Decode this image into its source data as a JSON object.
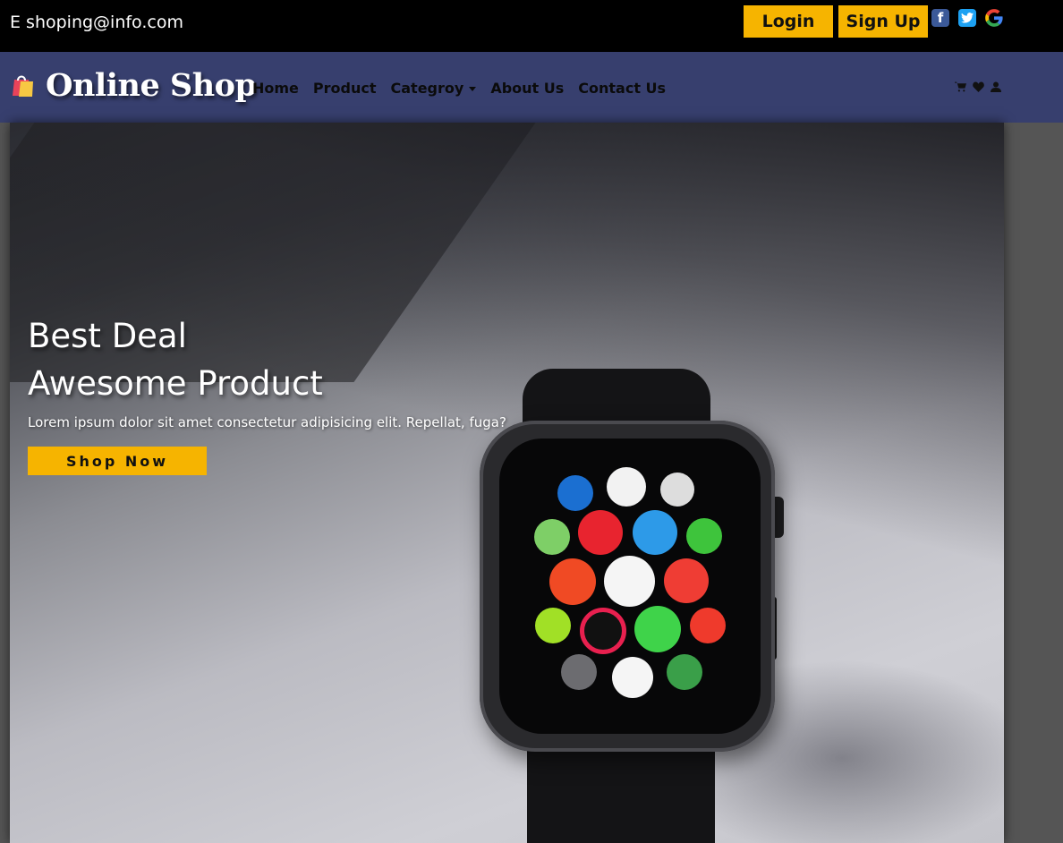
{
  "topbar": {
    "email": "E shoping@info.com",
    "login_label": "Login",
    "signup_label": "Sign Up",
    "social": [
      "facebook-icon",
      "twitter-icon",
      "google-icon"
    ]
  },
  "navbar": {
    "brand": "Online Shop",
    "links": [
      "Home",
      "Product",
      "Categroy",
      "About Us",
      "Contact Us"
    ],
    "icons": [
      "cart-icon",
      "heart-icon",
      "user-icon"
    ]
  },
  "hero": {
    "line1": "Best Deal",
    "line2": "Awesome Product",
    "description": "Lorem ipsum dolor sit amet consectetur adipisicing elit. Repellat, fuga?",
    "button_label": "Shop Now"
  },
  "colors": {
    "topbar": "#000000",
    "navbar": "#373f6e",
    "accent": "#f6b400"
  }
}
